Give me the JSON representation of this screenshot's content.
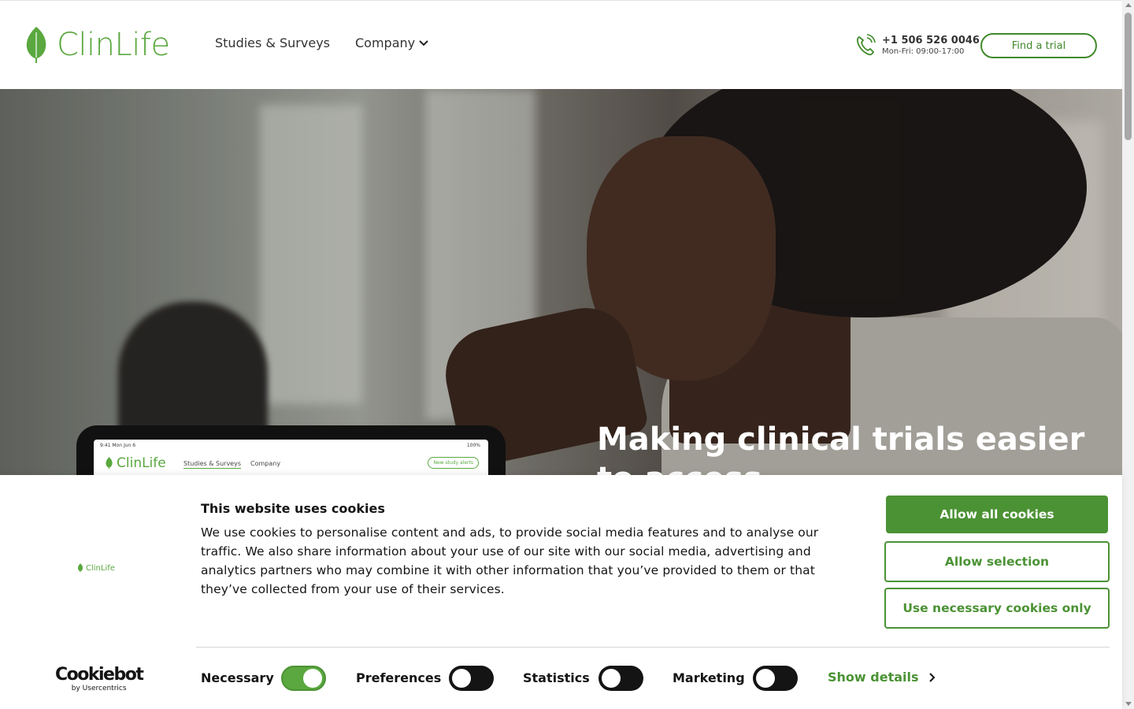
{
  "header": {
    "logo_text": "ClinLife",
    "nav": [
      {
        "label": "Studies & Surveys"
      },
      {
        "label": "Company"
      }
    ],
    "phone": "+1 506 526 0046",
    "hours": "Mon-Fri: 09:00-17:00",
    "find_trial_label": "Find a trial"
  },
  "hero": {
    "title": "Making clinical trials easier to access",
    "tablet": {
      "status_time": "9:41  Mon Jun 6",
      "status_right": "100%",
      "logo_text": "ClinLife",
      "nav_studies": "Studies & Surveys",
      "nav_company": "Company",
      "alert_button": "New study alerts"
    }
  },
  "cookie_banner": {
    "logo_text": "ClinLife",
    "title": "This website uses cookies",
    "body": "We use cookies to personalise content and ads, to provide social media features and to analyse our traffic. We also share information about your use of our site with our social media, advertising and analytics partners who may combine it with other information that you’ve provided to them or that they’ve collected from your use of their services.",
    "allow_all_label": "Allow all cookies",
    "allow_selection_label": "Allow selection",
    "necessary_only_label": "Use necessary cookies only",
    "provider_name": "Cookiebot",
    "provider_sub": "by Usercentrics",
    "toggles": [
      {
        "label": "Necessary",
        "on": true
      },
      {
        "label": "Preferences",
        "on": false
      },
      {
        "label": "Statistics",
        "on": false
      },
      {
        "label": "Marketing",
        "on": false
      }
    ],
    "show_details_label": "Show details"
  },
  "colors": {
    "brand_green": "#5aa83f",
    "button_green": "#4b9234",
    "dark": "#141414"
  },
  "icons": {
    "leaf": "leaf-icon",
    "phone": "phone-icon",
    "chevron_down": "chevron-down-icon",
    "chevron_right": "chevron-right-icon"
  }
}
